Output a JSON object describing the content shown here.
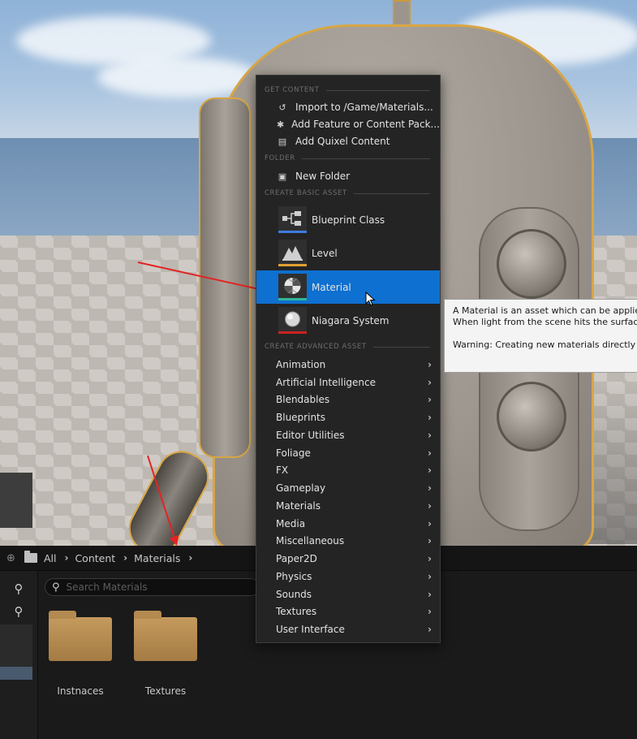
{
  "context_menu": {
    "sections": {
      "get_content": "GET CONTENT",
      "folder": "FOLDER",
      "create_basic_asset": "CREATE BASIC ASSET",
      "create_advanced_asset": "CREATE ADVANCED ASSET"
    },
    "get_content_items": [
      {
        "label": "Import to /Game/Materials...",
        "icon": "import-icon"
      },
      {
        "label": "Add Feature or Content Pack...",
        "icon": "feature-pack-icon"
      },
      {
        "label": "Add Quixel Content",
        "icon": "quixel-icon"
      }
    ],
    "folder_items": [
      {
        "label": "New Folder",
        "icon": "new-folder-icon"
      }
    ],
    "basic_assets": [
      {
        "label": "Blueprint Class",
        "icon": "blueprint-icon",
        "color": "#3d7be0"
      },
      {
        "label": "Level",
        "icon": "level-icon",
        "color": "#e0a030"
      },
      {
        "label": "Material",
        "icon": "material-icon",
        "color": "#2fb89a",
        "highlighted": true
      },
      {
        "label": "Niagara System",
        "icon": "niagara-icon",
        "color": "#cc2222"
      }
    ],
    "advanced_assets": [
      "Animation",
      "Artificial Intelligence",
      "Blendables",
      "Blueprints",
      "Editor Utilities",
      "Foliage",
      "FX",
      "Gameplay",
      "Materials",
      "Media",
      "Miscellaneous",
      "Paper2D",
      "Physics",
      "Sounds",
      "Textures",
      "User Interface"
    ]
  },
  "tooltip": {
    "line1": "A Material is an asset which can be applied",
    "line2": "When light from the scene hits the surface,",
    "line3": "Warning: Creating new materials directly in"
  },
  "content_browser": {
    "breadcrumbs": [
      "All",
      "Content",
      "Materials"
    ],
    "search_placeholder": "Search Materials",
    "folders": [
      "Instnaces",
      "Textures"
    ]
  },
  "colors": {
    "accent": "#0e70d0",
    "annotation": "#e32323"
  }
}
